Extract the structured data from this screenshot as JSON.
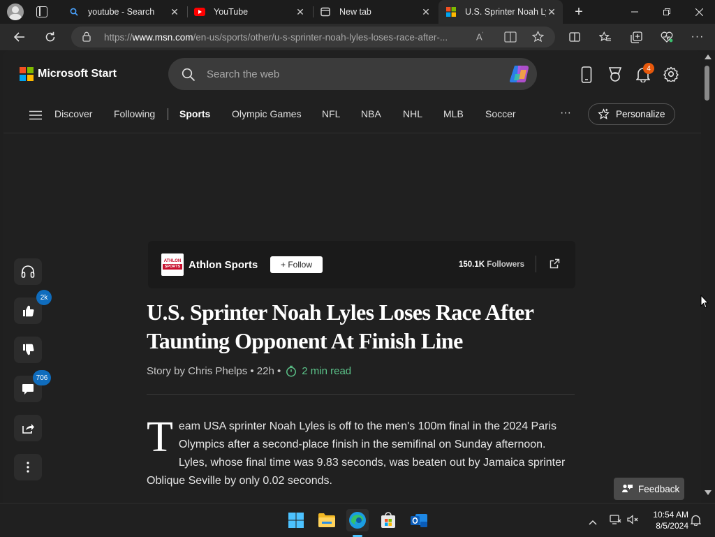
{
  "tabs": [
    {
      "label": "youtube - Search",
      "icon": "search-icon",
      "active": false
    },
    {
      "label": "YouTube",
      "icon": "youtube-icon",
      "active": false
    },
    {
      "label": "New tab",
      "icon": "new-tab-icon",
      "active": false
    },
    {
      "label": "U.S. Sprinter Noah Lyl",
      "icon": "msn-icon",
      "active": true
    }
  ],
  "address": {
    "prefix": "https://",
    "host": "www.msn.com",
    "path": "/en-us/sports/other/u-s-sprinter-noah-lyles-loses-race-after-..."
  },
  "header": {
    "logo_text": "Microsoft Start",
    "search_placeholder": "Search the web",
    "notification_count": "4",
    "logo_colors": [
      "#f25022",
      "#7fba00",
      "#00a4ef",
      "#ffb900"
    ]
  },
  "nav": {
    "items": [
      "Discover",
      "Following",
      "Sports",
      "Olympic Games",
      "NFL",
      "NBA",
      "NHL",
      "MLB",
      "Soccer"
    ],
    "active": "Sports",
    "more": "···",
    "personalize": "Personalize"
  },
  "rail": {
    "like_count": "2k",
    "comment_count": "706"
  },
  "source": {
    "name": "Athlon Sports",
    "logo_top": "ATHLON",
    "logo_bottom": "SPORTS",
    "follow": "+ Follow",
    "followers_count": "150.1K",
    "followers_label": "Followers"
  },
  "article": {
    "title": "U.S. Sprinter Noah Lyles Loses Race After Taunting Opponent At Finish Line",
    "byline": "Story by Chris Phelps • 22h •",
    "read_time": "2 min read",
    "dropcap": "T",
    "body": "eam USA sprinter Noah Lyles is off to the men's 100m final in the 2024 Paris Olympics after a second-place finish in the semifinal on Sunday afternoon. Lyles, whose final time was 9.83 seconds, was beaten out by Jamaica sprinter Oblique Seville by only 0.02 seconds."
  },
  "feedback": "Feedback",
  "taskbar": {
    "time": "10:54 AM",
    "date": "8/5/2024"
  },
  "colors": {
    "accent_blue": "#0f6cbd",
    "read_time_green": "#5cc48a",
    "notification_orange": "#e8590c"
  }
}
